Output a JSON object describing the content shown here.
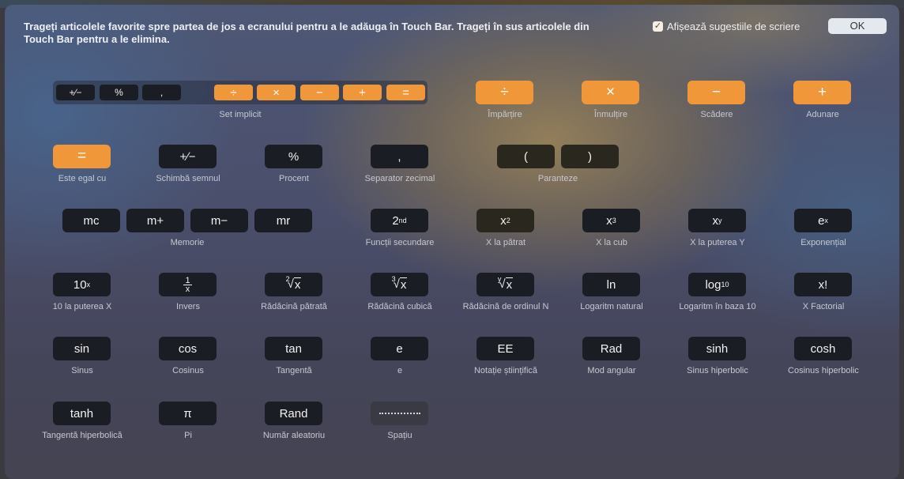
{
  "header": {
    "instructions": "Trageți articolele favorite spre partea de jos a ecranului pentru a le adăuga în Touch Bar. Trageți în sus articolele din Touch Bar pentru a le elimina.",
    "checkbox_label": "Afișează sugestiile de scriere",
    "checkbox_checked": true,
    "checkbox_mark": "✓",
    "ok_label": "OK"
  },
  "colors": {
    "accent_orange": "#f0973a",
    "key_dark": "#1b1d24",
    "ok_button": "#e4e8ef"
  },
  "default_set": {
    "label": "Set implicit",
    "keys": [
      "+∕−",
      "%",
      ",",
      "÷",
      "×",
      "−",
      "+",
      "="
    ]
  },
  "items": {
    "divide": {
      "key": "÷",
      "label": "Împărțire"
    },
    "multiply": {
      "key": "×",
      "label": "Înmulțire"
    },
    "subtract": {
      "key": "−",
      "label": "Scădere"
    },
    "add": {
      "key": "+",
      "label": "Adunare"
    },
    "equals": {
      "key": "=",
      "label": "Este egal cu"
    },
    "sign": {
      "key": "+∕−",
      "label": "Schimbă semnul"
    },
    "percent": {
      "key": "%",
      "label": "Procent"
    },
    "decimal": {
      "key": ",",
      "label": "Separator zecimal"
    },
    "parens": {
      "keys": [
        "(",
        ")"
      ],
      "label": "Paranteze"
    },
    "memory": {
      "keys": [
        "mc",
        "m+",
        "m−",
        "mr"
      ],
      "label": "Memorie"
    },
    "second": {
      "base": "2",
      "sup": "nd",
      "label": "Funcții secundare"
    },
    "square": {
      "base": "x",
      "sup": "2",
      "label": "X la pătrat"
    },
    "cube": {
      "base": "x",
      "sup": "3",
      "label": "X la cub"
    },
    "power_y": {
      "base": "x",
      "sup": "y",
      "label": "X la puterea Y"
    },
    "exp": {
      "base": "e",
      "sup": "x",
      "label": "Exponențial"
    },
    "ten_x": {
      "base": "10",
      "sup": "x",
      "label": "10 la puterea X"
    },
    "inverse": {
      "num": "1",
      "den": "x",
      "label": "Invers"
    },
    "sqrt": {
      "idx": "2",
      "rad": "√",
      "body": "x",
      "label": "Rădăcină pătrată"
    },
    "cbrt": {
      "idx": "3",
      "rad": "√",
      "body": "x",
      "label": "Rădăcină cubică"
    },
    "nroot": {
      "idx": "y",
      "rad": "√",
      "body": "x",
      "label": "Rădăcină de ordinul N"
    },
    "ln": {
      "key": "ln",
      "label": "Logaritm natural"
    },
    "log10": {
      "base": "log",
      "sub": "10",
      "label": "Logaritm în baza 10"
    },
    "factorial": {
      "key": "x!",
      "label": "X Factorial"
    },
    "sin": {
      "key": "sin",
      "label": "Sinus"
    },
    "cos": {
      "key": "cos",
      "label": "Cosinus"
    },
    "tan": {
      "key": "tan",
      "label": "Tangentă"
    },
    "e": {
      "key": "e",
      "label": "e"
    },
    "ee": {
      "key": "EE",
      "label": "Notație științifică"
    },
    "rad": {
      "key": "Rad",
      "label": "Mod angular"
    },
    "sinh": {
      "key": "sinh",
      "label": "Sinus hiperbolic"
    },
    "cosh": {
      "key": "cosh",
      "label": "Cosinus hiperbolic"
    },
    "tanh": {
      "key": "tanh",
      "label": "Tangentă hiperbolică"
    },
    "pi": {
      "key": "π",
      "label": "Pi"
    },
    "rand": {
      "key": "Rand",
      "label": "Număr aleatoriu"
    },
    "space": {
      "label": "Spațiu"
    }
  }
}
